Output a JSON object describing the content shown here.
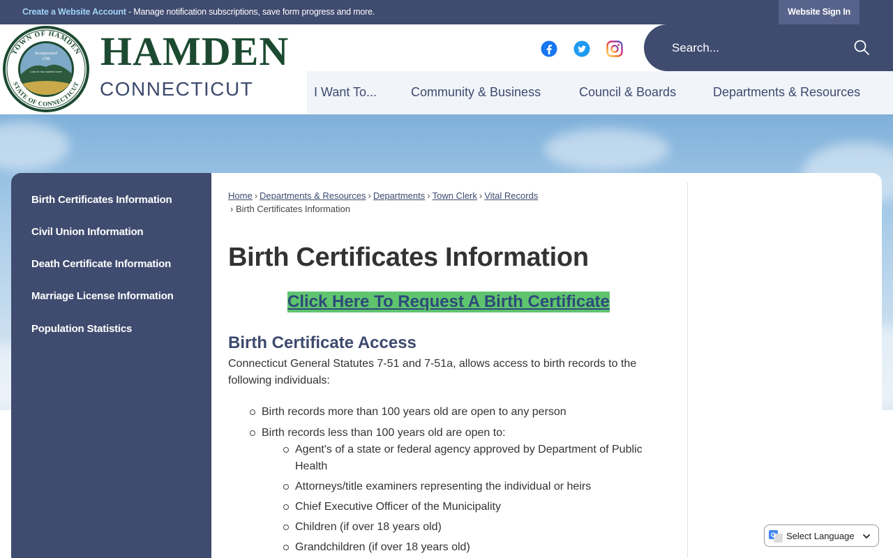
{
  "topbar": {
    "create_account": "Create a Website Account",
    "message": " - Manage notification subscriptions, save form progress and more.",
    "signin": "Website Sign In"
  },
  "logo": {
    "title": "HAMDEN",
    "subtitle": "CONNECTICUT",
    "seal_text_top": "TOWN OF HAMDEN",
    "seal_text_bottom": "STATE OF CONNECTICUT",
    "seal_incorporated": "Incorporated",
    "seal_year": "1786",
    "seal_motto": "LAND OF THE SLEEPING GIANT"
  },
  "social": [
    "facebook-icon",
    "twitter-icon",
    "instagram-icon"
  ],
  "search": {
    "placeholder": "Search..."
  },
  "nav": [
    "I Want To...",
    "Community & Business",
    "Council & Boards",
    "Departments & Resources"
  ],
  "sidebar": {
    "items": [
      "Birth Certificates Information",
      "Civil Union Information",
      "Death Certificate Information",
      "Marriage License Information",
      "Population Statistics"
    ]
  },
  "breadcrumb": {
    "links": [
      "Home",
      "Departments & Resources",
      "Departments",
      "Town Clerk",
      "Vital Records"
    ],
    "current": "Birth Certificates Information"
  },
  "page": {
    "title": "Birth Certificates Information",
    "request_link": "Click Here To Request A Birth Certificate",
    "section_title": "Birth Certificate Access",
    "intro": "Connecticut General Statutes 7-51 and 7-51a, allows access to birth records to the following individuals:",
    "list": {
      "item1": "Birth records more than 100 years old are open to any person",
      "item2": "Birth records less than 100 years old are open to:",
      "sub": [
        "Agent's of a state or federal agency approved by Department of Public Health",
        "Attorneys/title examiners representing the individual or heirs",
        "Chief Executive Officer of the Municipality",
        "Children (if over 18 years old)",
        "Grandchildren (if over 18 years old)"
      ]
    }
  },
  "translate": {
    "label": "Select Language"
  },
  "colors": {
    "navy": "#3f4b6f",
    "green_logo": "#1c4a31",
    "request_bg": "#5ec46e",
    "link": "#3d4a6e"
  }
}
